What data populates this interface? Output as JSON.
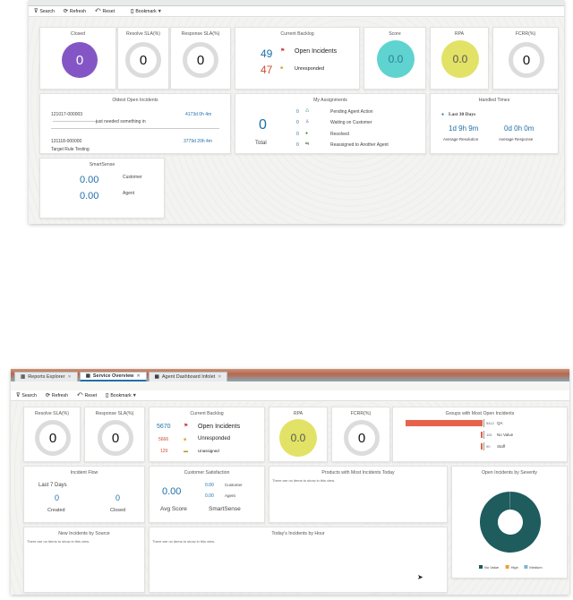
{
  "top": {
    "toolbar": {
      "search": "Search",
      "refresh": "Refresh",
      "reset": "Reset",
      "bookmark": "Bookmark"
    },
    "closed": {
      "title": "Closed",
      "value": "0"
    },
    "resolve": {
      "title": "Resolve SLA(%)",
      "value": "0"
    },
    "response": {
      "title": "Response SLA(%)",
      "value": "0"
    },
    "backlog": {
      "title": "Current Backlog",
      "open_count": "49",
      "open_label": "Open Incidents",
      "unresp_count": "47",
      "unresp_label": "Unresponded"
    },
    "score": {
      "title": "Score",
      "value": "0.0"
    },
    "rpa": {
      "title": "RPA",
      "value": "0.0"
    },
    "fcrr": {
      "title": "FCRR(%)",
      "value": "0"
    },
    "oldest": {
      "title": "Oldest Open Incidents",
      "r1_id": "121017-000003",
      "r1_time": "4173d 0h 4m",
      "r1_text": "just needed something in",
      "r2_id": "131118-000000",
      "r2_time": "3779d 20h 4m",
      "r2_text": "Target Rule Testing"
    },
    "assign": {
      "title": "My Assignments",
      "total": "0",
      "total_label": "Total",
      "items": [
        {
          "n": "0",
          "label": "Pending Agent Action"
        },
        {
          "n": "0",
          "label": "Waiting on Customer"
        },
        {
          "n": "0",
          "label": "Resolved"
        },
        {
          "n": "0",
          "label": "Reassigned to Another Agent"
        }
      ]
    },
    "handled": {
      "title": "Handled Times",
      "period": "Last 30 Days",
      "v1": "1d 9h 9m",
      "l1": "Average Resolution",
      "v2": "0d 0h 0m",
      "l2": "Average Response"
    },
    "smart": {
      "title": "SmartSense",
      "v1": "0.00",
      "l1": "Customer",
      "v2": "0.00",
      "l2": "Agent"
    }
  },
  "bottom": {
    "tabs": [
      {
        "label": "Reports Explorer"
      },
      {
        "label": "Service Overview"
      },
      {
        "label": "Agent Dashboard Infolet"
      }
    ],
    "toolbar": {
      "search": "Search",
      "refresh": "Refresh",
      "reset": "Reset",
      "bookmark": "Bookmark"
    },
    "resolve": {
      "title": "Resolve SLA(%)",
      "value": "0"
    },
    "response": {
      "title": "Response SLA(%)",
      "value": "0"
    },
    "backlog": {
      "title": "Current Backlog",
      "open_count": "5670",
      "open_label": "Open Incidents",
      "unresp_count": "5666",
      "unresp_label": "Unresponded",
      "unassigned_count": "129",
      "unassigned_label": "Unassigned"
    },
    "rpa": {
      "title": "RPA",
      "value": "0.0"
    },
    "fcrr": {
      "title": "FCRR(%)",
      "value": "0"
    },
    "groups": {
      "title": "Groups with Most Open Incidents"
    },
    "flow": {
      "title": "Incident Flow",
      "period": "Last 7 Days",
      "created": "0",
      "created_label": "Created",
      "closed": "0",
      "closed_label": "Closed"
    },
    "csat": {
      "title": "Customer Satisfaction",
      "avg": "0.00",
      "avg_label": "Avg Score",
      "c": "0.00",
      "c_label": "Customer",
      "a": "0.00",
      "a_label": "Agent",
      "smart_label": "SmartSense"
    },
    "products": {
      "title": "Products with Most Incidents Today",
      "empty": "There are no items to show in this view."
    },
    "severity": {
      "title": "Open Incidents by Severity"
    },
    "source": {
      "title": "New Incidents by Source",
      "empty": "There are no items to show in this view."
    },
    "hour": {
      "title": "Today's Incidents by Hour",
      "empty": "There are no items to show in this view."
    }
  },
  "chart_data": [
    {
      "type": "bar",
      "orientation": "horizontal",
      "title": "Groups with Most Open Incidents",
      "categories": [
        "QA",
        "No Value",
        "Staff"
      ],
      "values": [
        5412,
        115,
        90
      ]
    },
    {
      "type": "pie",
      "title": "Open Incidents by Severity",
      "categories": [
        "No Value",
        "High",
        "Medium"
      ],
      "values": [
        5660,
        5,
        5
      ],
      "colors": [
        "#1e5c5e",
        "#e8a23a",
        "#7fb3d5"
      ]
    }
  ]
}
